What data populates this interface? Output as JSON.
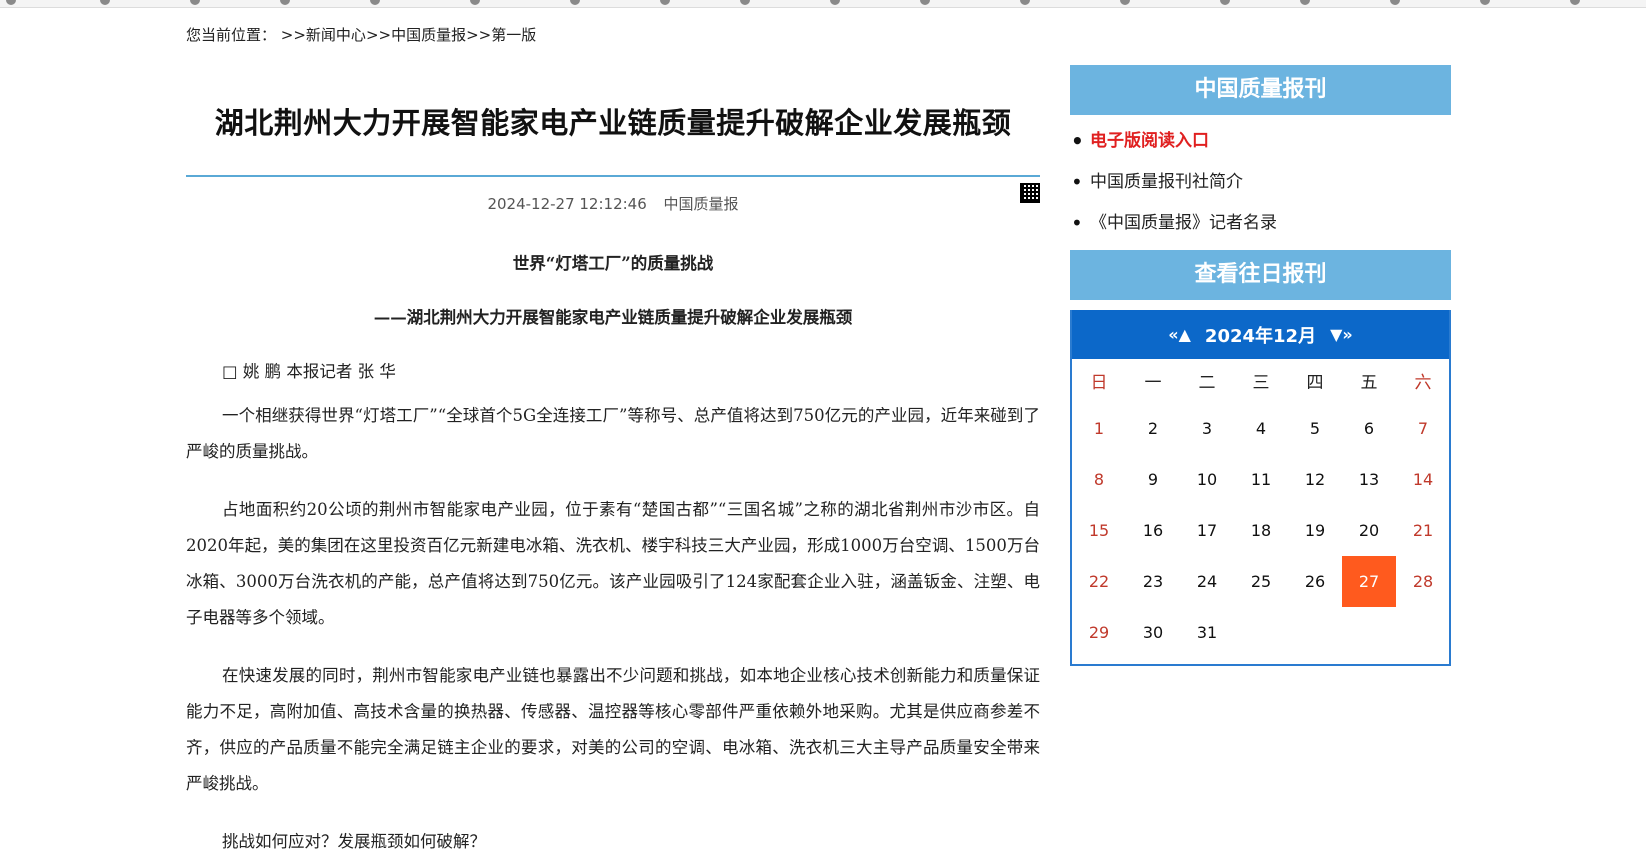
{
  "breadcrumb": {
    "prefix": "您当前位置：",
    "items": [
      ">>新闻中心",
      ">>中国质量报",
      ">>第一版"
    ]
  },
  "article": {
    "title": "湖北荆州大力开展智能家电产业链质量提升破解企业发展瓶颈",
    "date": "2024-12-27 12:12:46",
    "source": "中国质量报",
    "subtitle": "世界“灯塔工厂”的质量挑战",
    "subtitle2": "——湖北荆州大力开展智能家电产业链质量提升破解企业发展瓶颈",
    "byline": "□ 姚 鹏 本报记者 张 华",
    "paragraphs": [
      "一个相继获得世界“灯塔工厂”“全球首个5G全连接工厂”等称号、总产值将达到750亿元的产业园，近年来碰到了严峻的质量挑战。",
      "占地面积约20公顷的荆州市智能家电产业园，位于素有“楚国古都”“三国名城”之称的湖北省荆州市沙市区。自2020年起，美的集团在这里投资百亿元新建电冰箱、洗衣机、楼宇科技三大产业园，形成1000万台空调、1500万台冰箱、3000万台洗衣机的产能，总产值将达到750亿元。该产业园吸引了124家配套企业入驻，涵盖钣金、注塑、电子电器等多个领域。",
      "在快速发展的同时，荆州市智能家电产业链也暴露出不少问题和挑战，如本地企业核心技术创新能力和质量保证能力不足，高附加值、高技术含量的换热器、传感器、温控器等核心零部件严重依赖外地采购。尤其是供应商参差不齐，供应的产品质量不能完全满足链主企业的要求，对美的公司的空调、电冰箱、洗衣机三大主导产品质量安全带来严峻挑战。",
      "挑战如何应对？发展瓶颈如何破解？"
    ]
  },
  "sidebar": {
    "section1_title": "中国质量报刊",
    "links": [
      "电子版阅读入口",
      "中国质量报刊社简介",
      "《中国质量报》记者名录"
    ],
    "section2_title": "查看往日报刊"
  },
  "calendar": {
    "prev_label": "«▲",
    "next_label": "▼»",
    "month_label": "2024年12月",
    "weekdays": [
      "日",
      "一",
      "二",
      "三",
      "四",
      "五",
      "六"
    ],
    "first_weekday_index": 0,
    "days_in_month": 31,
    "selected_day": 27
  },
  "colors": {
    "accent": "#6cb4e0",
    "calendar_header": "#0c68c9",
    "today": "#ff5a1e",
    "weekend": "#c0392b",
    "link_highlight": "#e02020"
  }
}
